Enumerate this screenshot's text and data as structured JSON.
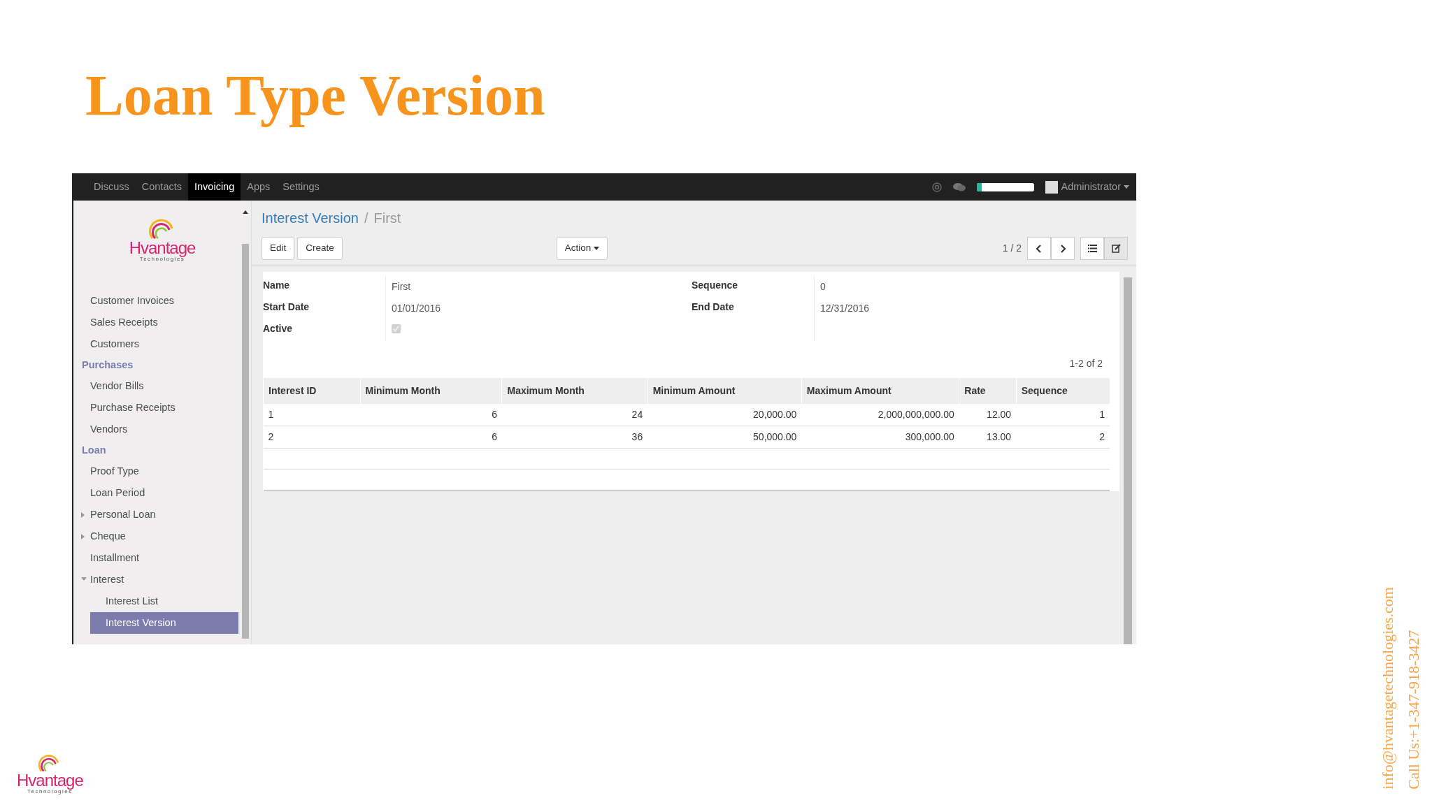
{
  "slide_title": "Loan Type Version",
  "top_nav": {
    "items": [
      {
        "label": "Discuss",
        "selected": false
      },
      {
        "label": "Contacts",
        "selected": false
      },
      {
        "label": "Invoicing",
        "selected": true
      },
      {
        "label": "Apps",
        "selected": false
      },
      {
        "label": "Settings",
        "selected": false
      }
    ],
    "user": "Administrator"
  },
  "sidebar": {
    "logo": {
      "name": "Hvantage",
      "tagline": "Technologies"
    },
    "sections": [
      {
        "items": [
          {
            "label": "Customer Invoices",
            "kind": "leaf",
            "selected": false
          },
          {
            "label": "Sales Receipts",
            "kind": "leaf",
            "selected": false
          },
          {
            "label": "Customers",
            "kind": "leaf",
            "selected": false
          }
        ]
      },
      {
        "heading": "Purchases",
        "items": [
          {
            "label": "Vendor Bills",
            "kind": "leaf",
            "selected": false
          },
          {
            "label": "Purchase Receipts",
            "kind": "leaf",
            "selected": false
          },
          {
            "label": "Vendors",
            "kind": "leaf",
            "selected": false
          }
        ]
      },
      {
        "heading": "Loan",
        "items": [
          {
            "label": "Proof Type",
            "kind": "leaf",
            "selected": false
          },
          {
            "label": "Loan Period",
            "kind": "leaf",
            "selected": false
          },
          {
            "label": "Personal Loan",
            "kind": "group",
            "expanded": false,
            "selected": false
          },
          {
            "label": "Cheque",
            "kind": "group",
            "expanded": false,
            "selected": false
          },
          {
            "label": "Installment",
            "kind": "leaf",
            "selected": false
          },
          {
            "label": "Interest",
            "kind": "group",
            "expanded": true,
            "selected": false,
            "children": [
              {
                "label": "Interest List",
                "kind": "leaf",
                "selected": false
              },
              {
                "label": "Interest Version",
                "kind": "leaf",
                "selected": true
              }
            ]
          }
        ]
      }
    ]
  },
  "breadcrumb_separator": "/",
  "breadcrumb": [
    {
      "label": "Interest Version",
      "kind": "link"
    },
    {
      "label": "First",
      "kind": "current"
    }
  ],
  "buttons": [
    "Edit",
    "Create"
  ],
  "action_button": "Action",
  "pager": "1 / 2",
  "views": [
    {
      "kind": "list",
      "selected": false
    },
    {
      "kind": "form",
      "selected": true
    }
  ],
  "form": {
    "left": [
      {
        "label": "Name",
        "kind": "text",
        "value": "First"
      },
      {
        "label": "Start Date",
        "kind": "text",
        "value": "01/01/2016"
      },
      {
        "label": "Active",
        "kind": "checkbox",
        "checked": true
      }
    ],
    "right": [
      {
        "label": "Sequence",
        "kind": "text",
        "value": "0"
      },
      {
        "label": "End Date",
        "kind": "text",
        "value": "12/31/2016"
      }
    ]
  },
  "table": {
    "pager": "1-2 of 2",
    "columns": [
      "Interest ID",
      "Minimum Month",
      "Maximum Month",
      "Minimum Amount",
      "Maximum Amount",
      "Rate",
      "Sequence"
    ],
    "rows": [
      [
        "1",
        "6",
        "24",
        "20,000.00",
        "2,000,000,000.00",
        "12.00",
        "1"
      ],
      [
        "2",
        "6",
        "36",
        "50,000.00",
        "300,000.00",
        "13.00",
        "2"
      ]
    ]
  },
  "footer": {
    "logo": {
      "name": "Hvantage",
      "tagline": "Technologies"
    },
    "contact": [
      "info@hvantagetechnologies.com",
      "Call Us:+1-347-918-3427"
    ]
  }
}
